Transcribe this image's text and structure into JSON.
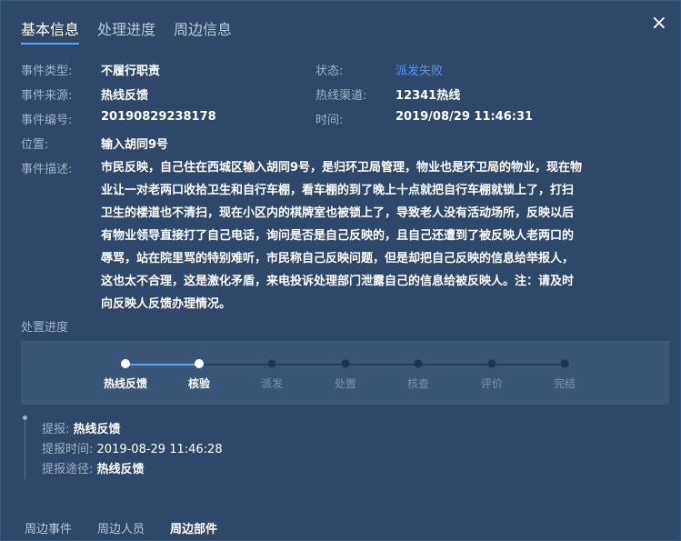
{
  "tabs": [
    "基本信息",
    "处理进度",
    "周边信息"
  ],
  "close_icon": "×",
  "fields": {
    "event_type": {
      "label": "事件类型:",
      "value": "不履行职责"
    },
    "status": {
      "label": "状态:",
      "value": "派发失败"
    },
    "source": {
      "label": "事件来源:",
      "value": "热线反馈"
    },
    "channel": {
      "label": "热线渠道:",
      "value": "12341热线"
    },
    "event_no": {
      "label": "事件编号:",
      "value": "20190829238178"
    },
    "time": {
      "label": "时间:",
      "value": "2019/08/29 11:46:31"
    },
    "location": {
      "label": "位置:",
      "value": "输入胡同9号"
    },
    "description": {
      "label": "事件描述:",
      "value": "市民反映，自己住在西城区输入胡同9号，是归环卫局管理，物业也是环卫局的物业，现在物业让一对老两口收拾卫生和自行车棚，看车棚的到了晚上十点就把自行车棚就锁上了，打扫卫生的楼道也不清扫，现在小区内的棋牌室也被锁上了，导致老人没有活动场所，反映以后有物业领导直接打了自己电话，询问是否是自己反映的，且自己还遭到了被反映人老两口的辱骂，站在院里骂的特别难听，市民称自己反映问题，但是却把自己反映的信息给举报人，这也太不合理，这是激化矛盾，来电投诉处理部门泄露自己的信息给被反映人。注：请及时向反映人反馈办理情况。"
    }
  },
  "progress": {
    "title": "处置进度",
    "steps": [
      "热线反馈",
      "核验",
      "派发",
      "处置",
      "核查",
      "评价",
      "完结"
    ],
    "completed_count": 2
  },
  "timeline": {
    "report": {
      "label": "提报:",
      "value": "热线反馈"
    },
    "report_time": {
      "label": "提报时间:",
      "value": "2019-08-29 11:46:28"
    },
    "report_channel": {
      "label": "提报途径:",
      "value": "热线反馈"
    }
  },
  "bottom_tabs": [
    "周边事件",
    "周边人员",
    "周边部件"
  ],
  "colors": {
    "accent": "#5aa7ff",
    "status_fail": "#4d97ff",
    "panel_bg": "#2f4869"
  }
}
